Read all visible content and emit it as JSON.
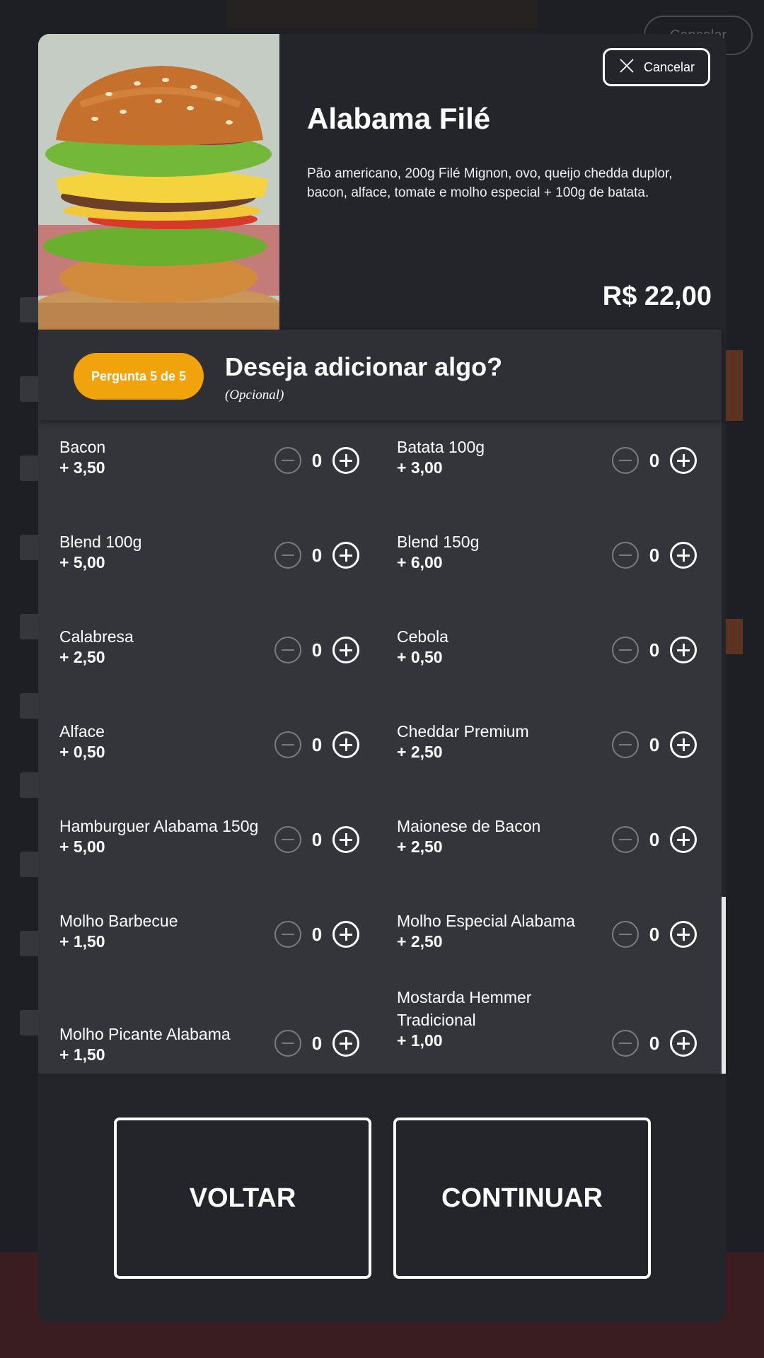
{
  "background": {
    "cancel_label": "Cancelar"
  },
  "product": {
    "title": "Alabama Filé",
    "description": "Pão americano, 200g Filé Mignon, ovo, queijo chedda duplor, bacon, alface, tomate e molho especial + 100g de batata.",
    "price": "R$ 22,00",
    "cancel_label": "Cancelar"
  },
  "question": {
    "badge": "Pergunta 5 de 5",
    "title": "Deseja adicionar algo?",
    "subtitle": "(Opcional)"
  },
  "options": [
    {
      "name": "Bacon",
      "price": "+ 3,50",
      "qty": "0"
    },
    {
      "name": "Batata 100g",
      "price": "+ 3,00",
      "qty": "0"
    },
    {
      "name": "Blend 100g",
      "price": "+ 5,00",
      "qty": "0"
    },
    {
      "name": "Blend 150g",
      "price": "+ 6,00",
      "qty": "0"
    },
    {
      "name": "Calabresa",
      "price": "+ 2,50",
      "qty": "0"
    },
    {
      "name": "Cebola",
      "price": "+ 0,50",
      "qty": "0"
    },
    {
      "name": "Alface",
      "price": "+ 0,50",
      "qty": "0"
    },
    {
      "name": "Cheddar Premium",
      "price": "+ 2,50",
      "qty": "0"
    },
    {
      "name": "Hamburguer Alabama 150g",
      "price": "+ 5,00",
      "qty": "0"
    },
    {
      "name": "Maionese de Bacon",
      "price": "+ 2,50",
      "qty": "0"
    },
    {
      "name": "Molho Barbecue",
      "price": "+ 1,50",
      "qty": "0"
    },
    {
      "name": "Molho Especial Alabama",
      "price": "+ 2,50",
      "qty": "0"
    },
    {
      "name": "Molho Picante Alabama",
      "price": "+ 1,50",
      "qty": "0"
    },
    {
      "name": "Mostarda Hemmer Tradicional",
      "price": "+ 1,00",
      "qty": "0"
    }
  ],
  "footer": {
    "back_label": "VOLTAR",
    "continue_label": "CONTINUAR"
  },
  "colors": {
    "accent": "#f0a30a",
    "modal_bg": "#24252b",
    "list_bg": "#34353b"
  }
}
